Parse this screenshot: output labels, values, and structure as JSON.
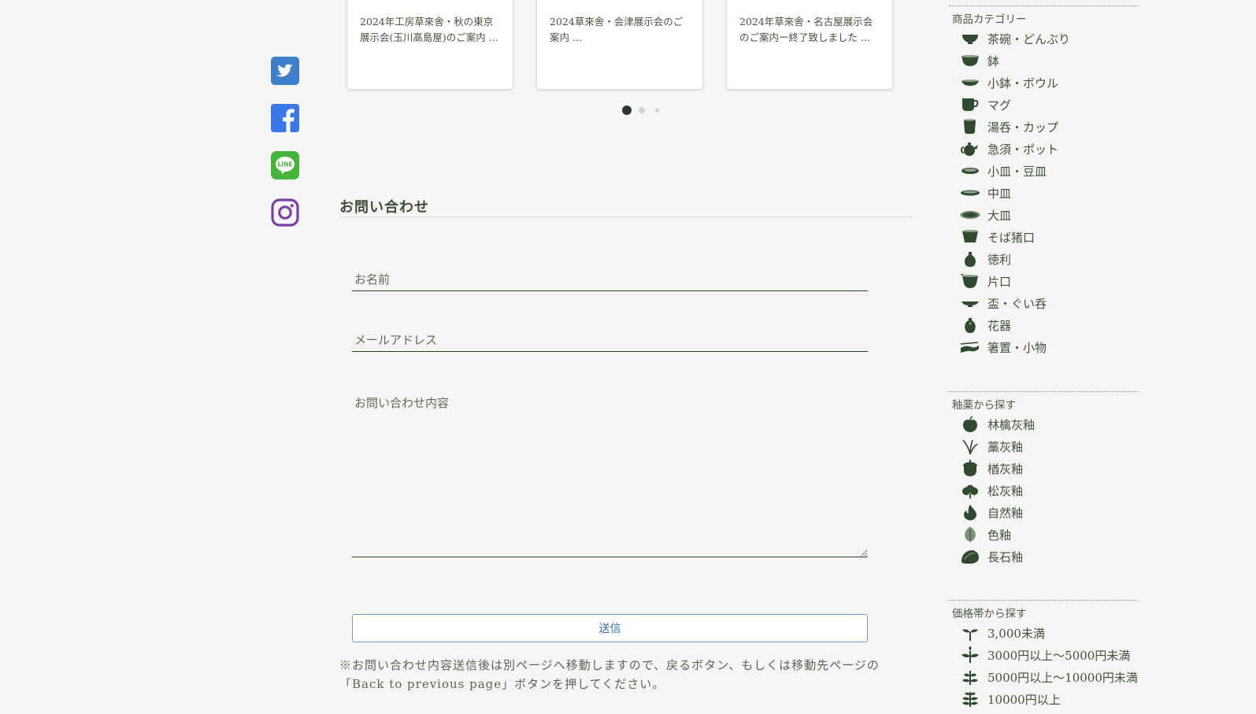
{
  "social": [
    {
      "name": "twitter",
      "icon": "twitter-icon",
      "color": "#3f7ecb"
    },
    {
      "name": "facebook",
      "icon": "facebook-icon",
      "color": "#3a77e8"
    },
    {
      "name": "line",
      "icon": "line-icon",
      "color": "#45b43a"
    },
    {
      "name": "instagram",
      "icon": "instagram-icon",
      "color": "#7b3fa6"
    }
  ],
  "news": {
    "cards": [
      {
        "text": "2024年工房草來舎・秋の東京展示会(玉川髙島屋)のご案内 ..."
      },
      {
        "text": "2024草來舎・会津展示会のご案内 ..."
      },
      {
        "text": "2024年草來舎・名古屋展示会のご案内ー終了致しました ..."
      }
    ],
    "pagination": {
      "current": 1,
      "total": 3
    }
  },
  "contact": {
    "title": "お問い合わせ",
    "name_placeholder": "お名前",
    "email_placeholder": "メールアドレス",
    "message_placeholder": "お問い合わせ内容",
    "submit_label": "送信",
    "note": "※お問い合わせ内容送信後は別ページへ移動しますので、戻るボタン、もしくは移動先ページの「Back to previous page」ボタンを押してください。"
  },
  "sidebar": {
    "categories": {
      "heading": "商品カテゴリー",
      "items": [
        {
          "label": "茶碗・どんぶり",
          "icon": "bowl-icon"
        },
        {
          "label": "鉢",
          "icon": "deep-bowl-icon"
        },
        {
          "label": "小鉢・ボウル",
          "icon": "small-bowl-icon"
        },
        {
          "label": "マグ",
          "icon": "mug-icon"
        },
        {
          "label": "湯呑・カップ",
          "icon": "teacup-icon"
        },
        {
          "label": "急須・ポット",
          "icon": "teapot-icon"
        },
        {
          "label": "小皿・豆皿",
          "icon": "small-plate-icon"
        },
        {
          "label": "中皿",
          "icon": "medium-plate-icon"
        },
        {
          "label": "大皿",
          "icon": "large-plate-icon"
        },
        {
          "label": "そば猪口",
          "icon": "soba-cup-icon"
        },
        {
          "label": "徳利",
          "icon": "sake-bottle-icon"
        },
        {
          "label": "片口",
          "icon": "katakuchi-icon"
        },
        {
          "label": "盃・ぐい呑",
          "icon": "sake-cup-icon"
        },
        {
          "label": "花器",
          "icon": "vase-icon"
        },
        {
          "label": "箸置・小物",
          "icon": "chopstick-rest-icon"
        }
      ]
    },
    "glazes": {
      "heading": "釉薬から探す",
      "items": [
        {
          "label": "林檎灰釉",
          "icon": "apple-icon"
        },
        {
          "label": "藁灰釉",
          "icon": "straw-icon"
        },
        {
          "label": "楢灰釉",
          "icon": "acorn-icon"
        },
        {
          "label": "松灰釉",
          "icon": "pine-icon"
        },
        {
          "label": "自然釉",
          "icon": "flame-icon"
        },
        {
          "label": "色釉",
          "icon": "leaf-icon"
        },
        {
          "label": "長石釉",
          "icon": "stone-icon"
        }
      ]
    },
    "prices": {
      "heading": "価格帯から探す",
      "items": [
        {
          "label": "3,000未満",
          "icon": "sprout-icon"
        },
        {
          "label": "3000円以上〜5000円未満",
          "icon": "seedling-icon"
        },
        {
          "label": "5000円以上〜10000円未満",
          "icon": "young-plant-icon"
        },
        {
          "label": "10000円以上",
          "icon": "plant-icon"
        }
      ]
    }
  },
  "colors": {
    "accent": "#2f4a30",
    "background": "#f5f5f3",
    "submit_border": "#6e9ac7"
  }
}
